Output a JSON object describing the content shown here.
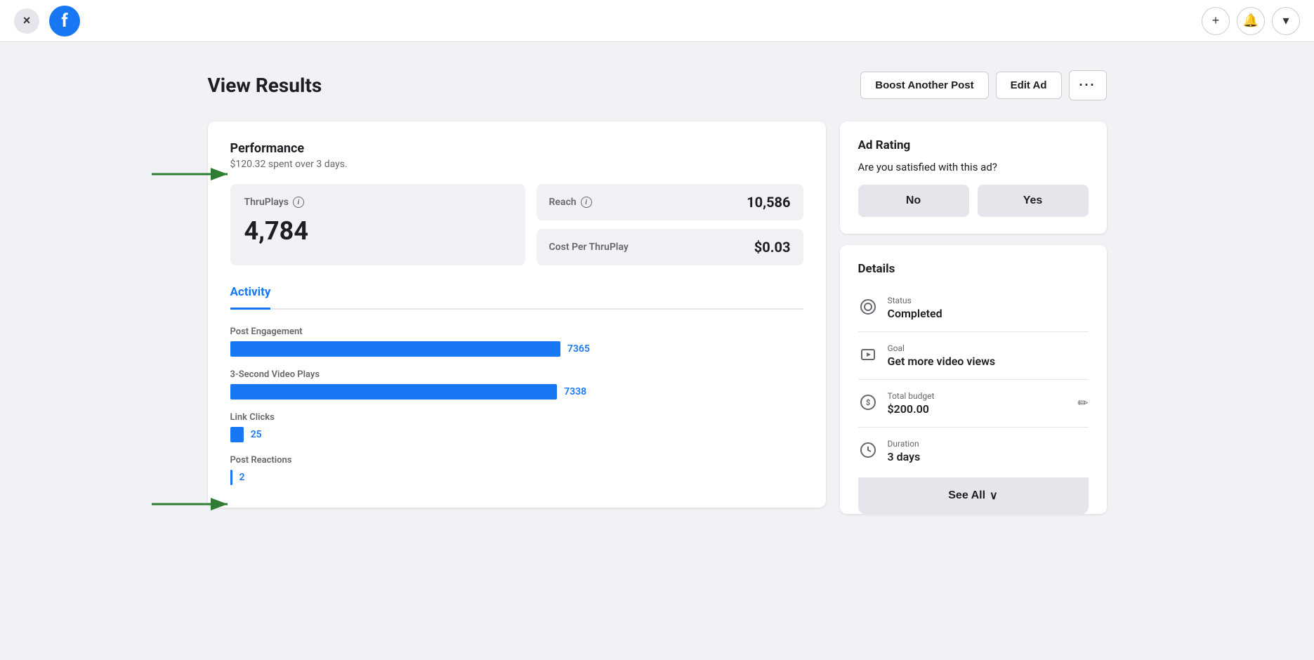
{
  "topbar": {
    "close_label": "×",
    "fb_logo": "f",
    "add_icon": "+",
    "bell_icon": "🔔",
    "dropdown_icon": "▾"
  },
  "header": {
    "title": "View Results",
    "boost_button": "Boost Another Post",
    "edit_button": "Edit Ad",
    "more_button": "···"
  },
  "performance": {
    "title": "Performance",
    "subtitle": "$120.32 spent over 3 days.",
    "thruplay_label": "ThruPlays",
    "thruplay_value": "4,784",
    "reach_label": "Reach",
    "reach_value": "10,586",
    "cost_label": "Cost Per ThruPlay",
    "cost_value": "$0.03"
  },
  "activity": {
    "tab_label": "Activity",
    "bars": [
      {
        "label": "Post Engagement",
        "value": "7365",
        "width_pct": 98
      },
      {
        "label": "3-Second Video Plays",
        "value": "7338",
        "width_pct": 97
      },
      {
        "label": "Link Clicks",
        "value": "25",
        "width_pct": 4
      },
      {
        "label": "Post Reactions",
        "value": "2",
        "width_pct": 0.5
      }
    ]
  },
  "ad_rating": {
    "title": "Ad Rating",
    "question": "Are you satisfied with this ad?",
    "no_label": "No",
    "yes_label": "Yes"
  },
  "details": {
    "title": "Details",
    "status_label": "Status",
    "status_value": "Completed",
    "goal_label": "Goal",
    "goal_value": "Get more video views",
    "budget_label": "Total budget",
    "budget_value": "$200.00",
    "duration_label": "Duration",
    "duration_value": "3 days",
    "see_all_label": "See All",
    "chevron": "∨"
  }
}
